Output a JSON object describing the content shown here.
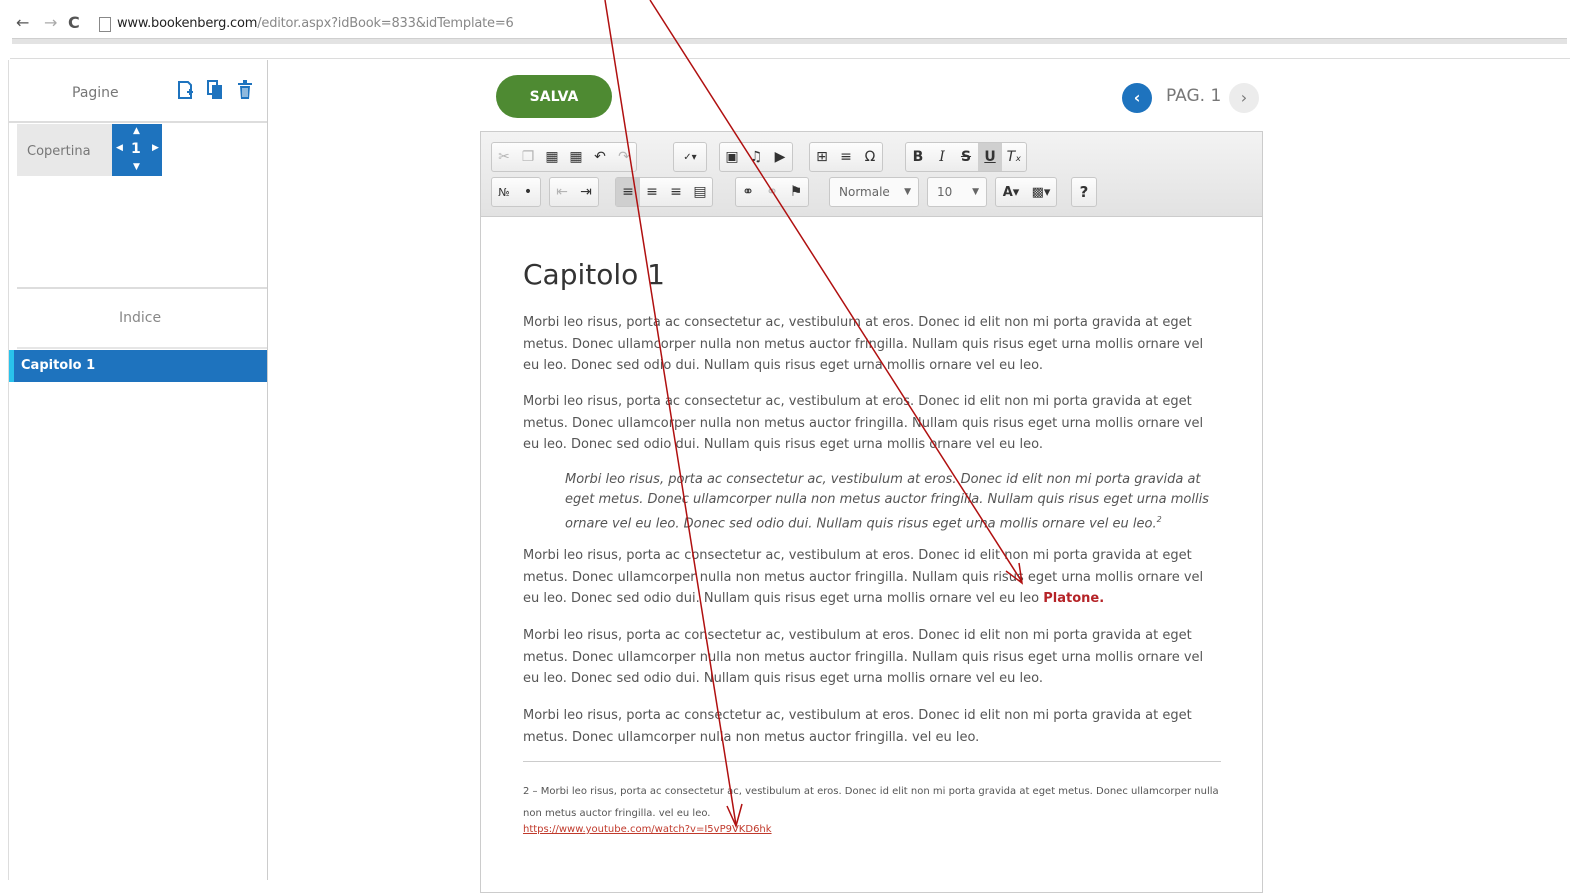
{
  "browser": {
    "url_host": "www.bookenberg.com",
    "url_rest": "/editor.aspx?idBook=833&idTemplate=6"
  },
  "sidebar": {
    "pages_title": "Pagine",
    "cover_label": "Copertina",
    "current_page": "1",
    "index_title": "Indice",
    "index_items": [
      {
        "label": "Capitolo 1",
        "selected": true
      }
    ]
  },
  "actions": {
    "save_label": "SALVA"
  },
  "pagination": {
    "label": "PAG. 1"
  },
  "toolbar": {
    "format_value": "Normale",
    "size_value": "10"
  },
  "document": {
    "heading": "Capitolo 1",
    "paragraphs": [
      "Morbi leo risus, porta ac consectetur ac, vestibulum at eros. Donec id elit non mi porta gravida at eget metus. Donec ullamcorper nulla non metus auctor fringilla. Nullam quis risus eget urna mollis ornare vel eu leo. Donec sed odio dui. Nullam quis risus eget urna mollis ornare vel eu leo.",
      "Morbi leo risus, porta ac consectetur ac, vestibulum at eros. Donec id elit non mi porta gravida at eget metus. Donec ullamcorper nulla non metus auctor fringilla. Nullam quis risus eget urna mollis ornare vel eu leo. Donec sed odio dui. Nullam quis risus eget urna mollis ornare vel eu leo.",
      "Morbi leo risus, porta ac consectetur ac, vestibulum at eros. Donec id elit non mi porta gravida at eget metus. Donec ullamcorper nulla non metus auctor fringilla. Nullam quis risus eget urna mollis ornare vel eu leo. Donec sed odio dui. Nullam quis risus eget urna mollis ornare vel eu leo",
      "Morbi leo risus, porta ac consectetur ac, vestibulum at eros. Donec id elit non mi porta gravida at eget metus. Donec ullamcorper nulla non metus auctor fringilla. Nullam quis risus eget urna mollis ornare vel eu leo. Donec sed odio dui. Nullam quis risus eget urna mollis ornare vel eu leo.",
      "Morbi leo risus, porta ac consectetur ac, vestibulum at eros. Donec id elit non mi porta gravida at eget metus. Donec ullamcorper nulla non metus auctor fringilla. vel eu leo."
    ],
    "quote": "Morbi leo risus, porta ac consectetur ac, vestibulum at eros. Donec id elit non mi porta gravida at eget metus. Donec ullamcorper nulla non metus auctor fringilla. Nullam quis risus eget urna mollis ornare vel eu leo. Donec sed odio dui. Nullam quis risus eget urna mollis ornare vel eu leo.",
    "quote_sup": "2",
    "highlight_word": "Platone.",
    "footnote": "2 – Morbi leo risus, porta ac consectetur ac, vestibulum at eros. Donec id elit non mi porta gravida at eget metus. Donec ullamcorper nulla non metus auctor fringilla. vel eu leo.",
    "footnote_link": "https://www.youtube.com/watch?v=I5vP9VKD6hk"
  },
  "colors": {
    "save_green": "#4e8a32",
    "accent_blue": "#1e73be",
    "highlight_red": "#b52327",
    "annotation_arrow": "#b01010"
  }
}
